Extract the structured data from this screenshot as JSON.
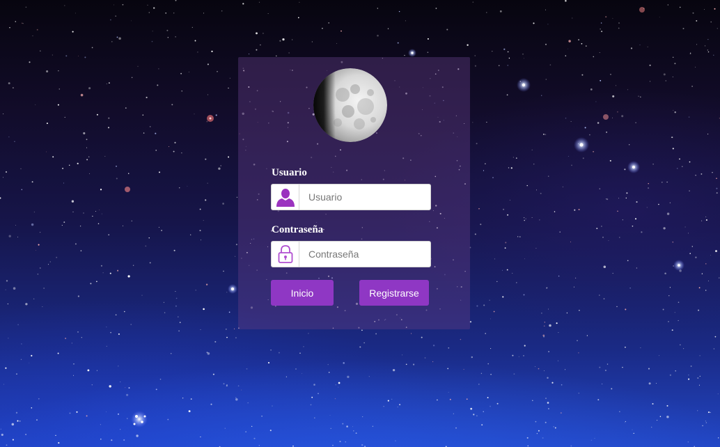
{
  "login": {
    "username_label": "Usuario",
    "username_placeholder": "Usuario",
    "username_icon": "user-icon",
    "password_label": "Contraseña",
    "password_placeholder": "Contraseña",
    "password_icon": "padlock-icon",
    "login_button": "Inicio",
    "register_button": "Registrarse"
  },
  "colors": {
    "accent": "#8f37c4",
    "icon": "#9b33bf",
    "card": "#5f3c82"
  }
}
